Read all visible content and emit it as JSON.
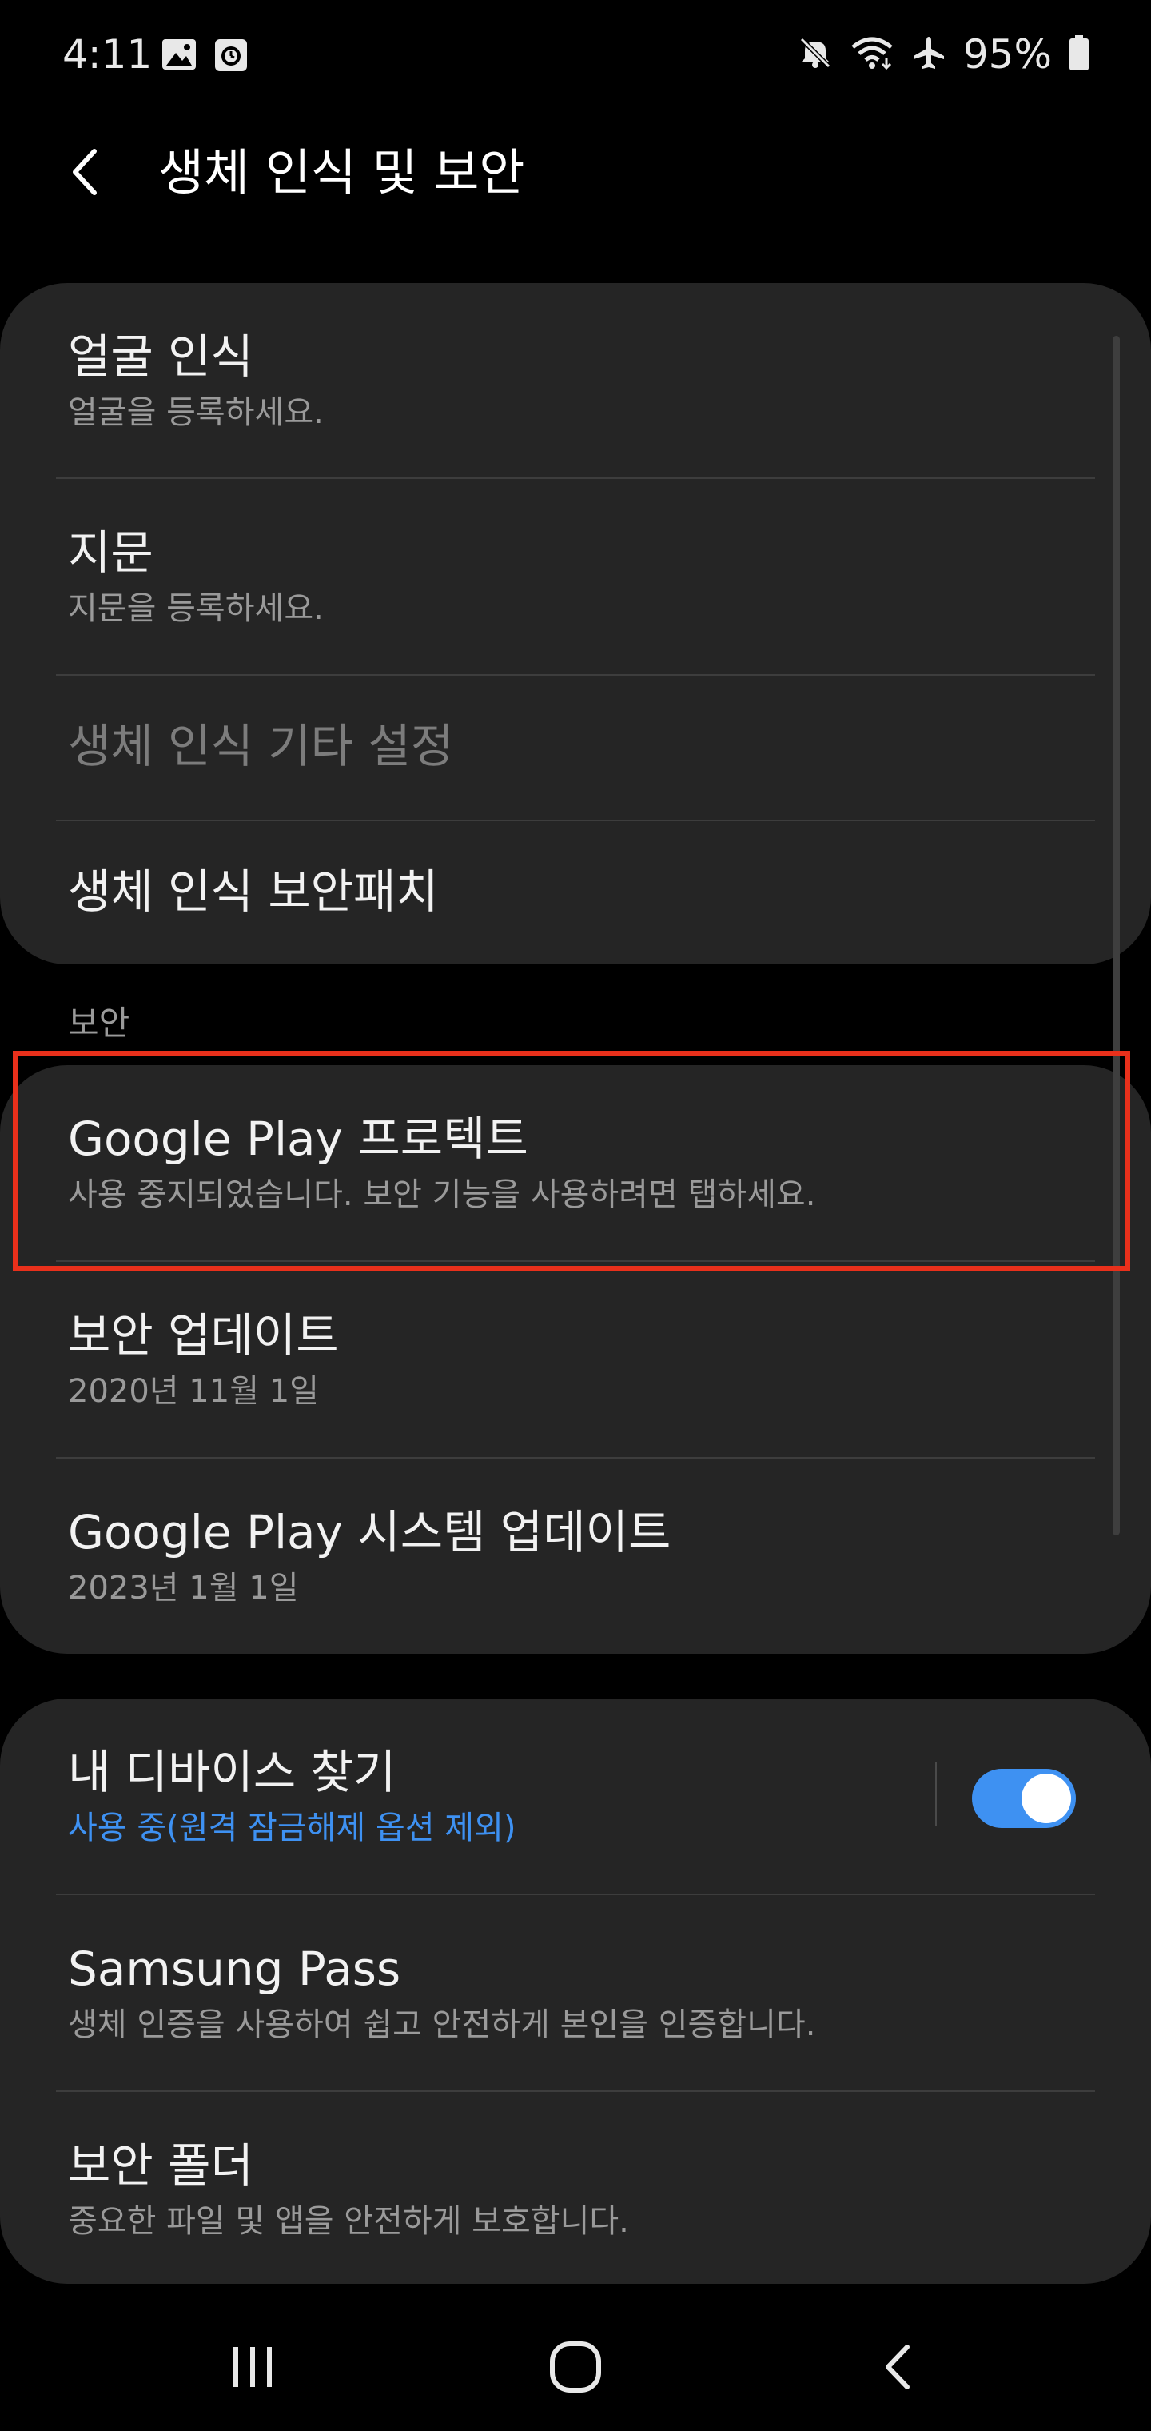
{
  "status_bar": {
    "time": "4:11",
    "battery_percent": "95%",
    "left_icons": [
      "gallery-icon",
      "alarm-clock-icon"
    ],
    "right_icons": [
      "mute-icon",
      "wifi-icon",
      "airplane-icon",
      "battery-icon"
    ]
  },
  "header": {
    "title": "생체 인식 및 보안"
  },
  "biometrics": {
    "items": [
      {
        "title": "얼굴 인식",
        "subtitle": "얼굴을 등록하세요."
      },
      {
        "title": "지문",
        "subtitle": "지문을 등록하세요."
      },
      {
        "title": "생체 인식 기타 설정",
        "disabled": true
      },
      {
        "title": "생체 인식 보안패치"
      }
    ]
  },
  "security_section": {
    "label": "보안",
    "items": [
      {
        "title": "Google Play 프로텍트",
        "subtitle": "사용 중지되었습니다. 보안 기능을 사용하려면 탭하세요."
      },
      {
        "title": "보안 업데이트",
        "subtitle": "2020년 11월 1일"
      },
      {
        "title": "Google Play 시스템 업데이트",
        "subtitle": "2023년 1월 1일"
      }
    ]
  },
  "device_section": {
    "items": [
      {
        "title": "내 디바이스 찾기",
        "subtitle": "사용 중(원격 잠금해제 옵션 제외)",
        "toggle_on": true
      },
      {
        "title": "Samsung Pass",
        "subtitle": "생체 인증을 사용하여 쉽고 안전하게 본인을 인증합니다."
      },
      {
        "title": "보안 폴더",
        "subtitle": "중요한 파일 및 앱을 안전하게 보호합니다."
      }
    ]
  },
  "nav_bar": {
    "buttons": [
      "recents-icon",
      "home-icon",
      "back-icon"
    ]
  },
  "colors": {
    "background": "#000000",
    "card": "#252525",
    "accent": "#3e91f2",
    "highlight": "#e9301b"
  }
}
